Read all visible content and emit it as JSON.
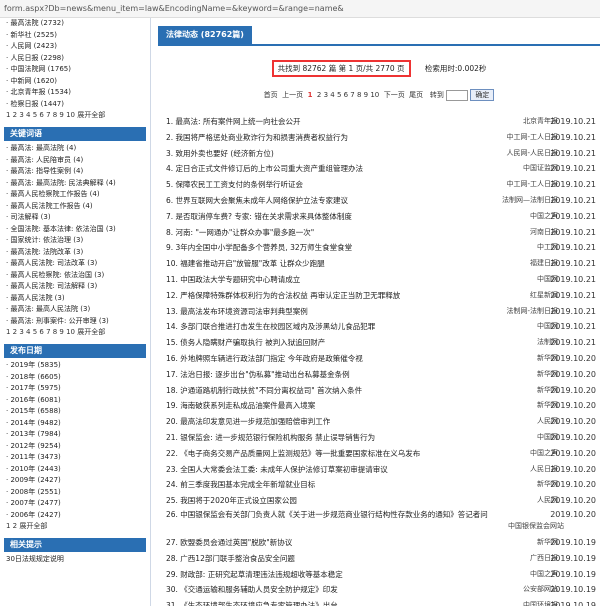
{
  "url": "form.aspx?Db=news&menu_item=law&EncodingName=&keyword=&range=name&",
  "sidebar": {
    "top_items": [
      {
        "label": "· 最高法院 (2732)"
      },
      {
        "label": "· 新华社 (2525)"
      },
      {
        "label": "· 人民网 (2423)"
      },
      {
        "label": "· 人民日报 (2298)"
      },
      {
        "label": "· 中国法院网 (1765)"
      },
      {
        "label": "· 中新网 (1620)"
      },
      {
        "label": "· 北京青年报 (1534)"
      },
      {
        "label": "· 检察日报 (1447)"
      }
    ],
    "top_pager": "1 2 3 4 5 6 7 8 9 10 展开全部",
    "section_keywords": "关键词语",
    "keyword_items": [
      {
        "label": "· 最高法: 最高法院 (4)"
      },
      {
        "label": "· 最高法: 人民陪审员 (4)"
      },
      {
        "label": "· 最高法: 指导性案例 (4)"
      },
      {
        "label": "· 最高法: 最高法院: 民法典解释 (4)"
      },
      {
        "label": "· 最高人民检察院工作报告 (4)"
      },
      {
        "label": "· 最高人民法院工作报告 (4)"
      },
      {
        "label": "· 司法解释 (3)"
      },
      {
        "label": "· 全国法院: 基本法律: 依法治国 (3)"
      },
      {
        "label": "· 国家统计: 依法治理 (3)"
      },
      {
        "label": "· 最高法院: 法院改革 (3)"
      },
      {
        "label": "· 最高人民法院: 司法改革 (3)"
      },
      {
        "label": "· 最高人民检察院: 依法治国 (3)"
      },
      {
        "label": "· 最高人民法院: 司法解释 (3)"
      },
      {
        "label": "· 最高人民法院 (3)"
      },
      {
        "label": "· 最高法: 最高人民法院 (3)"
      },
      {
        "label": "· 最高法: 刑事案件: 公开审理 (3)"
      }
    ],
    "keyword_pager": "1 2 3 4 5 6 7 8 9 10 展开全部",
    "section_dates": "发布日期",
    "date_items": [
      {
        "label": "· 2019年 (5835)"
      },
      {
        "label": "· 2018年 (6605)"
      },
      {
        "label": "· 2017年 (5975)"
      },
      {
        "label": "· 2016年 (6081)"
      },
      {
        "label": "· 2015年 (6588)"
      },
      {
        "label": "· 2014年 (9482)"
      },
      {
        "label": "· 2013年 (7984)"
      },
      {
        "label": "· 2012年 (9254)"
      },
      {
        "label": "· 2011年 (3473)"
      },
      {
        "label": "· 2010年 (2443)"
      },
      {
        "label": "· 2009年 (2427)"
      },
      {
        "label": "· 2008年 (2551)"
      },
      {
        "label": "· 2007年 (2477)"
      },
      {
        "label": "· 2006年 (2427)"
      }
    ],
    "date_pager": "1 2 展开全部",
    "section_related": "相关提示",
    "related_first": "30日法规规定说明"
  },
  "main": {
    "tab_label": "法律动态 (82762篇)",
    "summary_box": "共找到 82762 篇   第 1 页/共 2770 页",
    "summary_time": "检索用时:0.002秒",
    "pager": {
      "first": "首页",
      "prev": "上一页",
      "current": "1",
      "pages": "2 3 4 5 6 7 8 9 10",
      "next": "下一页",
      "last": "尾页",
      "goto_label": "转到",
      "go": "确定"
    },
    "articles": [
      {
        "title": "1.  最高法: 所有案件网上统一向社会公开",
        "source": "北京青年报",
        "date": "2019.10.21"
      },
      {
        "title": "2.  我国将严格惩处商业欺诈行为和损害消费者权益行为",
        "source": "中工网-工人日报",
        "date": "2019.10.21"
      },
      {
        "title": "3.  致用外卖也要好 (经济新方位)",
        "source": "人民网-人民日报",
        "date": "2019.10.21"
      },
      {
        "title": "4.  定日合正式文件修订后的上市公司重大资产重组管理办法",
        "source": "中国证监网",
        "date": "2019.10.21"
      },
      {
        "title": "5.  保障农民工工资支付的条例举行听证会",
        "source": "中工网-工人日报",
        "date": "2019.10.21"
      },
      {
        "title": "6.  世界互联网大会聚焦未成年人网络保护立法专家建议",
        "source": "法制网—法制日报",
        "date": "2019.10.21"
      },
      {
        "title": "7.  是否取消停车费? 专家: 错在关求需求来具体整体制度",
        "source": "中国之声",
        "date": "2019.10.21"
      },
      {
        "title": "8.  河南: \"一网通办\"让群众办事\"最多跑一次\"",
        "source": "河南日报",
        "date": "2019.10.21"
      },
      {
        "title": "9.  3年内全国中小学配备多个营养员, 32万师生食堂食堂",
        "source": "中工网",
        "date": "2019.10.21"
      },
      {
        "title": "10. 福建省推动开启\"放管服\"改革 让群众少跑腿",
        "source": "福建日报",
        "date": "2019.10.21"
      },
      {
        "title": "11. 中国政法大学专题研究中心聘请成立",
        "source": "中国网",
        "date": "2019.10.21"
      },
      {
        "title": "12. 严格保障特殊群体权利行为的合法权益 再审认定正当防卫无罪释放",
        "source": "红星新闻",
        "date": "2019.10.21"
      },
      {
        "title": "13. 最高法发布环境资源司法审判典型案例",
        "source": "法制网-法制日报",
        "date": "2019.10.21"
      },
      {
        "title": "14. 多部门联合推进打击发生在校园区域内及涉黑幼儿食品犯罪",
        "source": "中国网",
        "date": "2019.10.21"
      },
      {
        "title": "15. 债务人隐瞒财产骗取执行 被判入狱追回财产",
        "source": "法制网",
        "date": "2019.10.21"
      },
      {
        "title": "16. 外地牌照车辆进行政法部门指定 今年政府是政策催令视",
        "source": "新华网",
        "date": "2019.10.20"
      },
      {
        "title": "17. 法治日报: 逐步出台\"伪私募\"推动出台私募基金条例",
        "source": "新华网",
        "date": "2019.10.20"
      },
      {
        "title": "18. 沪通道路机制行政扶贫\"不同分离权益司\" 首次纳入条件",
        "source": "新华网",
        "date": "2019.10.20"
      },
      {
        "title": "19. 海南破获系列走私成品油案件最高入境案",
        "source": "新华网",
        "date": "2019.10.20"
      },
      {
        "title": "20. 最高法印发意见进一步规范加强赔偿审判工作",
        "source": "人民网",
        "date": "2019.10.20"
      },
      {
        "title": "21. 银保监会: 进一步规范银行保险机构服务 禁止误导销售行为",
        "source": "中国网",
        "date": "2019.10.20"
      },
      {
        "title": "22. 《电子商务交易产品质量网上监测规范》等一批重要国家标准在义乌发布",
        "source": "中国之声",
        "date": "2019.10.20"
      },
      {
        "title": "23. 全国人大常委会法工委: 未成年人保护法修订草案初审提请审议",
        "source": "人民日报",
        "date": "2019.10.20"
      },
      {
        "title": "24. 前三季度我国基本完成全年新增就业目标",
        "source": "新华网",
        "date": "2019.10.20"
      },
      {
        "title": "25. 我国将于2020年正式设立国家公园",
        "source": "人民网",
        "date": "2019.10.20"
      },
      {
        "title": "26. 中国银保监会有关部门负责人就《关于进一步规范商业银行结构性存款业务的通知》答记者问",
        "source": "中国银保监会网站",
        "date": "2019.10.20",
        "wrap": true
      },
      {
        "title": "27. 欧盟委员会通过英国\"脱欧\"新协议",
        "source": "新华网",
        "date": "2019.10.19"
      },
      {
        "title": "28. 广西12部门联手整治食品安全问题",
        "source": "广西日报",
        "date": "2019.10.19"
      },
      {
        "title": "29. 财政部: 正研究起草清理违法违规超收等基本稳定",
        "source": "中国之声",
        "date": "2019.10.19"
      },
      {
        "title": "30. 《交通运输和服务辅助人员安全防护规定》印发",
        "source": "公安部网站",
        "date": "2019.10.19"
      },
      {
        "title": "31. 《生态环境部生态环境应急专家管理办法》出台",
        "source": "中国环境报",
        "date": "2019.10.19"
      }
    ]
  }
}
